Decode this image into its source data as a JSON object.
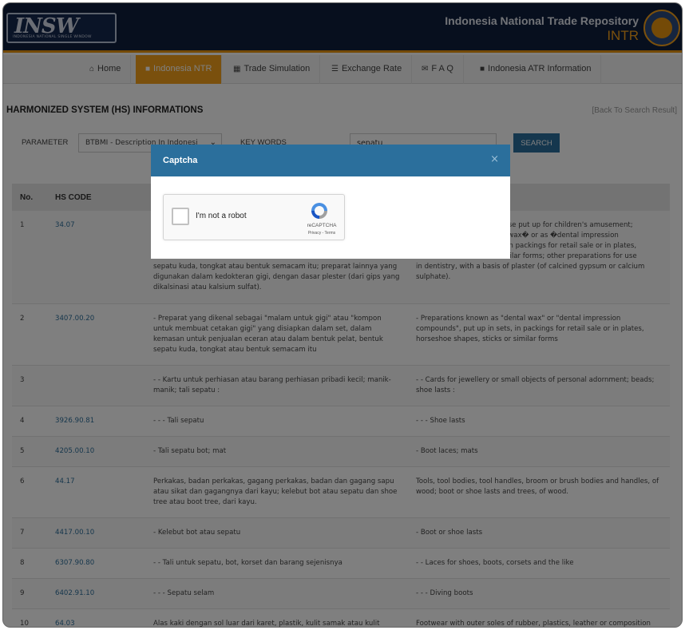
{
  "header": {
    "logo_text": "INSW",
    "logo_subtext": "INDONESIA NATIONAL SINGLE WINDOW",
    "title": "Indonesia National Trade Repository",
    "subtitle": "INTR"
  },
  "nav": {
    "items": [
      {
        "label": "Home",
        "icon": "home-icon"
      },
      {
        "label": "Indonesia NTR",
        "icon": "book-icon"
      },
      {
        "label": "Trade Simulation",
        "icon": "grid-icon"
      },
      {
        "label": "Exchange Rate",
        "icon": "barcode-icon"
      },
      {
        "label": "F A Q",
        "icon": "envelope-icon"
      },
      {
        "label": "Indonesia ATR Information",
        "icon": "book-icon"
      }
    ],
    "active_index": 1
  },
  "page": {
    "title": "HARMONIZED SYSTEM (HS) INFORMATIONS",
    "back_link": "[Back To Search Result]"
  },
  "filters": {
    "parameter_label": "PARAMETER",
    "parameter_value": "BTBMI - Description In Indonesi",
    "keywords_label": "KEY WORDS",
    "keywords_value": "sepatu",
    "search_label": "SEARCH"
  },
  "table": {
    "headers": [
      "No.",
      "HS CODE",
      "",
      ""
    ],
    "rows": [
      {
        "no": "1",
        "hs": "34.07",
        "id": "sepatu kuda, tongkat atau bentuk semacam itu; preparat lainnya yang digunakan dalam kedokteran gigi, dengan dasar plester (dari gips yang dikalsinasi atau kalsium sulfat).",
        "en": "in dentistry, with a basis of plaster (of calcined gypsum or calcium sulphate)."
      },
      {
        "no": "2",
        "hs": "3407.00.20",
        "id": "- Preparat yang dikenal sebagai \"malam untuk gigi\" atau \"kompon untuk membuat cetakan gigi\" yang disiapkan dalam set, dalam kemasan untuk penjualan eceran atau dalam bentuk pelat, bentuk sepatu kuda, tongkat atau bentuk semacam itu",
        "en": "- Preparations known as \"dental wax\" or \"dental impression compounds\", put up in sets, in packings for retail sale or in plates, horseshoe shapes, sticks or similar forms"
      },
      {
        "no": "3",
        "hs": "",
        "id": "- - Kartu untuk perhiasan atau barang perhiasan pribadi kecil; manik-manik; tali sepatu :",
        "en": "- - Cards for jewellery or small objects of personal adornment; beads; shoe lasts :"
      },
      {
        "no": "4",
        "hs": "3926.90.81",
        "id": "- - - Tali sepatu",
        "en": "- - - Shoe lasts"
      },
      {
        "no": "5",
        "hs": "4205.00.10",
        "id": "- Tali sepatu bot; mat",
        "en": "- Boot laces; mats"
      },
      {
        "no": "6",
        "hs": "44.17",
        "id": "Perkakas, badan perkakas, gagang perkakas, badan dan gagang sapu atau sikat dan gagangnya dari kayu; kelebut bot atau sepatu dan shoe tree atau boot tree, dari kayu.",
        "en": "Tools, tool bodies, tool handles, broom or brush bodies and handles, of wood; boot or shoe lasts and trees, of wood."
      },
      {
        "no": "7",
        "hs": "4417.00.10",
        "id": "- Kelebut bot atau sepatu",
        "en": "- Boot or shoe lasts"
      },
      {
        "no": "8",
        "hs": "6307.90.80",
        "id": "- - Tali untuk sepatu, bot, korset dan barang sejenisnya",
        "en": "- - Laces for shoes, boots, corsets and the like"
      },
      {
        "no": "9",
        "hs": "6402.91.10",
        "id": "- - - Sepatu selam",
        "en": "- - - Diving boots"
      },
      {
        "no": "10",
        "hs": "64.03",
        "id": "Alas kaki dengan sol luar dari karet, plastik, kulit samak atau kulit komposisi dan bagian atas sepatu dari kulit samak.",
        "en": "Footwear with outer soles of rubber, plastics, leather or composition leather and uppers of leather."
      }
    ],
    "row1_partial_en_top": "; those put up for children's amusement;",
    "row1_partial_en_mid1": "ntal wax� or as �dental impression",
    "row1_partial_en_mid2": "cts, in packings for retail sale or in plates,",
    "row1_partial_en_mid3": "r similar forms; other preparations for use"
  },
  "modal": {
    "title": "Captcha",
    "close": "×",
    "recaptcha_label": "I'm not a robot",
    "recaptcha_brand": "reCAPTCHA",
    "recaptcha_links": "Privacy - Terms"
  },
  "colors": {
    "header_bg": "#0f1e3c",
    "accent": "#f4a11b",
    "primary": "#2b6f9c"
  }
}
